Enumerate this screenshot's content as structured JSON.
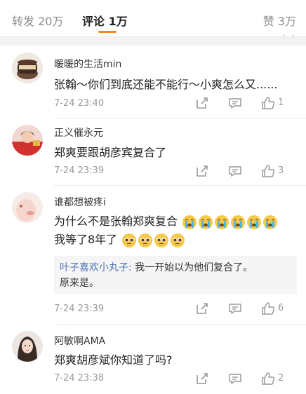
{
  "tabs": {
    "repost": "转发 20万",
    "comment": "评论 1万",
    "like": "赞 3万"
  },
  "comments": [
    {
      "username": "暖暖的生活min",
      "text": "张翰～你们到底还能不能行～小爽怎么又......",
      "time": "7-24 23:40",
      "likes": "1"
    },
    {
      "username": "正义催永元",
      "text": "郑爽要跟胡彦宾复合了",
      "time": "7-24 23:39",
      "likes": "3"
    },
    {
      "username": "谁都想被疼i",
      "text_line1": "为什么不是张翰郑爽复合",
      "text_line2": "我等了8年了",
      "reply_name": "叶子喜欢小丸子:",
      "reply_text": " 我一开始以为他们复合了。",
      "reply_text2": "原来是。",
      "time": "7-24 23:39",
      "likes": "6"
    },
    {
      "username": "阿敏啊AMA",
      "text": "郑爽胡彦斌你知道了吗?",
      "time": "7-24 23:38",
      "likes": "2"
    }
  ],
  "icons": {
    "share": "share-icon",
    "reply": "comment-bubble-icon",
    "like": "thumbs-up-icon",
    "crying": "crying-face-icon",
    "pleading": "pleading-face-icon"
  },
  "colors": {
    "accent": "#f38a1f",
    "link": "#4a73b8",
    "muted": "#9a9a9a"
  }
}
